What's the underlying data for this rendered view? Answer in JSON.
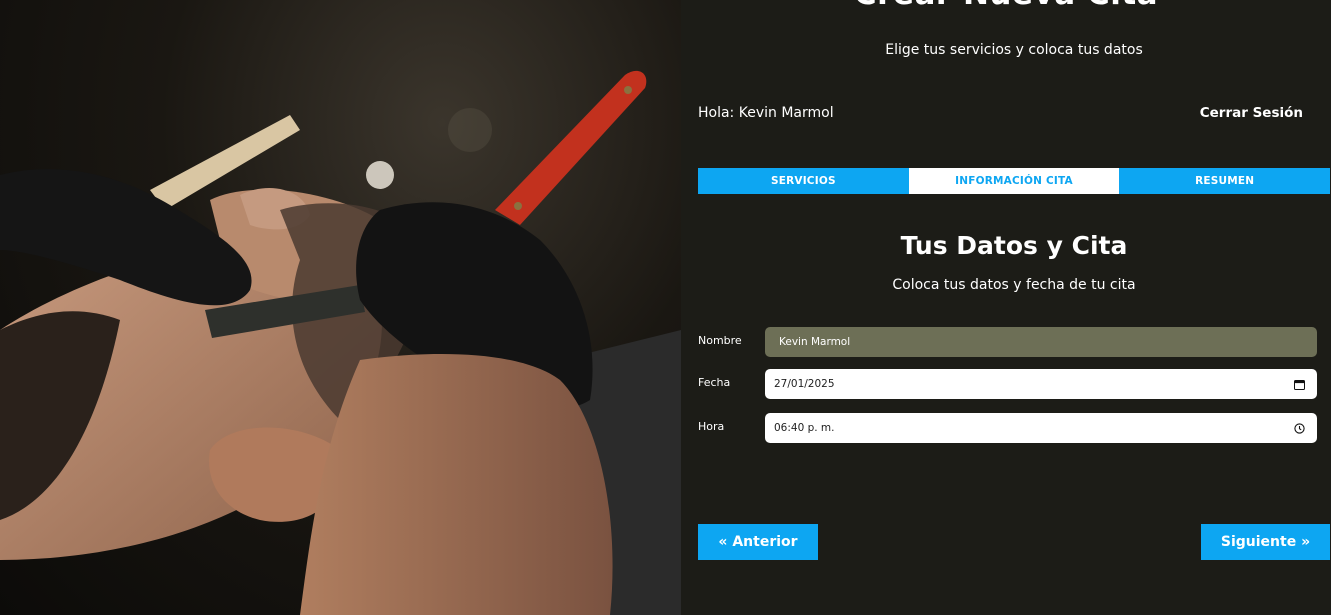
{
  "header": {
    "title": "Crear Nueva Cita",
    "subtitle": "Elige tus servicios y coloca tus datos"
  },
  "user_bar": {
    "greeting": "Hola: Kevin Marmol",
    "logout_label": "Cerrar Sesión"
  },
  "tabs": [
    {
      "label": "SERVICIOS",
      "active": false
    },
    {
      "label": "INFORMACIÓN CITA",
      "active": true
    },
    {
      "label": "RESUMEN",
      "active": false
    }
  ],
  "section": {
    "title": "Tus Datos y Cita",
    "subtitle": "Coloca tus datos y fecha de tu cita"
  },
  "form": {
    "name_label": "Nombre",
    "name_value": "Kevin Marmol",
    "date_label": "Fecha",
    "date_value": "27/01/2025",
    "time_label": "Hora",
    "time_value": "06:40 p. m."
  },
  "nav": {
    "prev_label": "« Anterior",
    "next_label": "Siguiente »"
  },
  "colors": {
    "accent": "#0da6f2",
    "background": "#1c1c17",
    "readonly_field": "#6d6f56"
  },
  "icons": {
    "date": "calendar-icon",
    "time": "clock-icon"
  }
}
